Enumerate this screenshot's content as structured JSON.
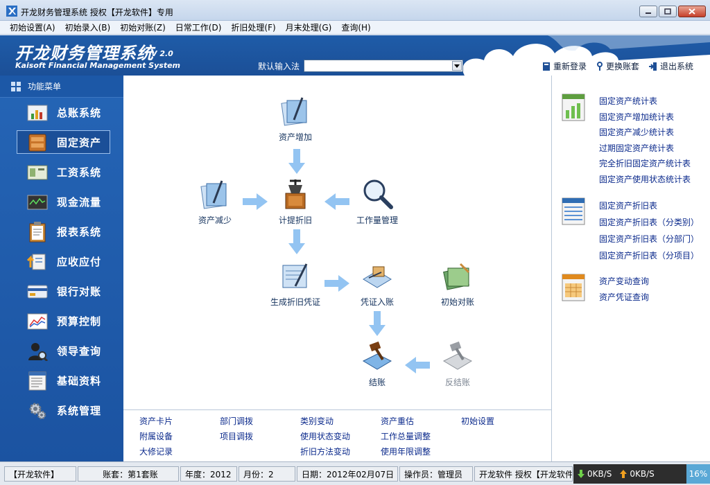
{
  "window": {
    "title": "开龙财务管理系统 授权【开龙软件】专用"
  },
  "menu": [
    {
      "label": "初始设置(A)"
    },
    {
      "label": "初始录入(B)"
    },
    {
      "label": "初始对账(Z)"
    },
    {
      "label": "日常工作(D)"
    },
    {
      "label": "折旧处理(F)"
    },
    {
      "label": "月末处理(G)"
    },
    {
      "label": "查询(H)"
    }
  ],
  "banner": {
    "title": "开龙财务管理系统",
    "version": "V 2.0",
    "subtitle": "Kaisoft Financial Management System",
    "ime_label": "默认输入法",
    "ime_value": "",
    "actions": [
      {
        "label": "重新登录"
      },
      {
        "label": "更换账套"
      },
      {
        "label": "退出系统"
      }
    ]
  },
  "sidebar": {
    "header": "功能菜单",
    "items": [
      {
        "label": "总账系统"
      },
      {
        "label": "固定资产"
      },
      {
        "label": "工资系统"
      },
      {
        "label": "现金流量"
      },
      {
        "label": "报表系统"
      },
      {
        "label": "应收应付"
      },
      {
        "label": "银行对账"
      },
      {
        "label": "预算控制"
      },
      {
        "label": "领导查询"
      },
      {
        "label": "基础资料"
      },
      {
        "label": "系统管理"
      }
    ],
    "active_index": 1
  },
  "flow": {
    "asset_add": "资产增加",
    "asset_reduce": "资产减少",
    "depreciation": "计提折旧",
    "workload": "工作量管理",
    "gen_voucher": "生成折旧凭证",
    "voucher_post": "凭证入账",
    "initial_recon": "初始对账",
    "close": "结账",
    "reverse_close": "反结账"
  },
  "links": {
    "col1": [
      "资产卡片",
      "附属设备",
      "大修记录"
    ],
    "col2": [
      "部门调拨",
      "项目调拨"
    ],
    "col3": [
      "类别变动",
      "使用状态变动",
      "折旧方法变动"
    ],
    "col4": [
      "资产重估",
      "工作总量调整",
      "使用年限调整"
    ],
    "col5": [
      "初始设置"
    ]
  },
  "right": {
    "group1": [
      "固定资产统计表",
      "固定资产增加统计表",
      "固定资产减少统计表",
      "过期固定资产统计表",
      "完全折旧固定资产统计表",
      "固定资产使用状态统计表"
    ],
    "group2": [
      "固定资产折旧表",
      "固定资产折旧表（分类别）",
      "固定资产折旧表（分部门）",
      "固定资产折旧表（分项目）"
    ],
    "group3": [
      "资产变动查询",
      "资产凭证查询"
    ]
  },
  "status": {
    "company": "【开龙软件】",
    "account": "账套：第1套账",
    "year": "年度：2012",
    "month": "月份：2",
    "date": "日期：2012年02月07日",
    "operator": "操作员：管理员",
    "license": "开龙软件 授权【开龙软件",
    "down": "0KB/S",
    "up": "0KB/S",
    "pct": "16%"
  },
  "colors": {
    "banner": "#1f5ca8",
    "sidebar": "#2565b6",
    "link": "#0b2a8c",
    "arrow": "#93c4f2"
  }
}
